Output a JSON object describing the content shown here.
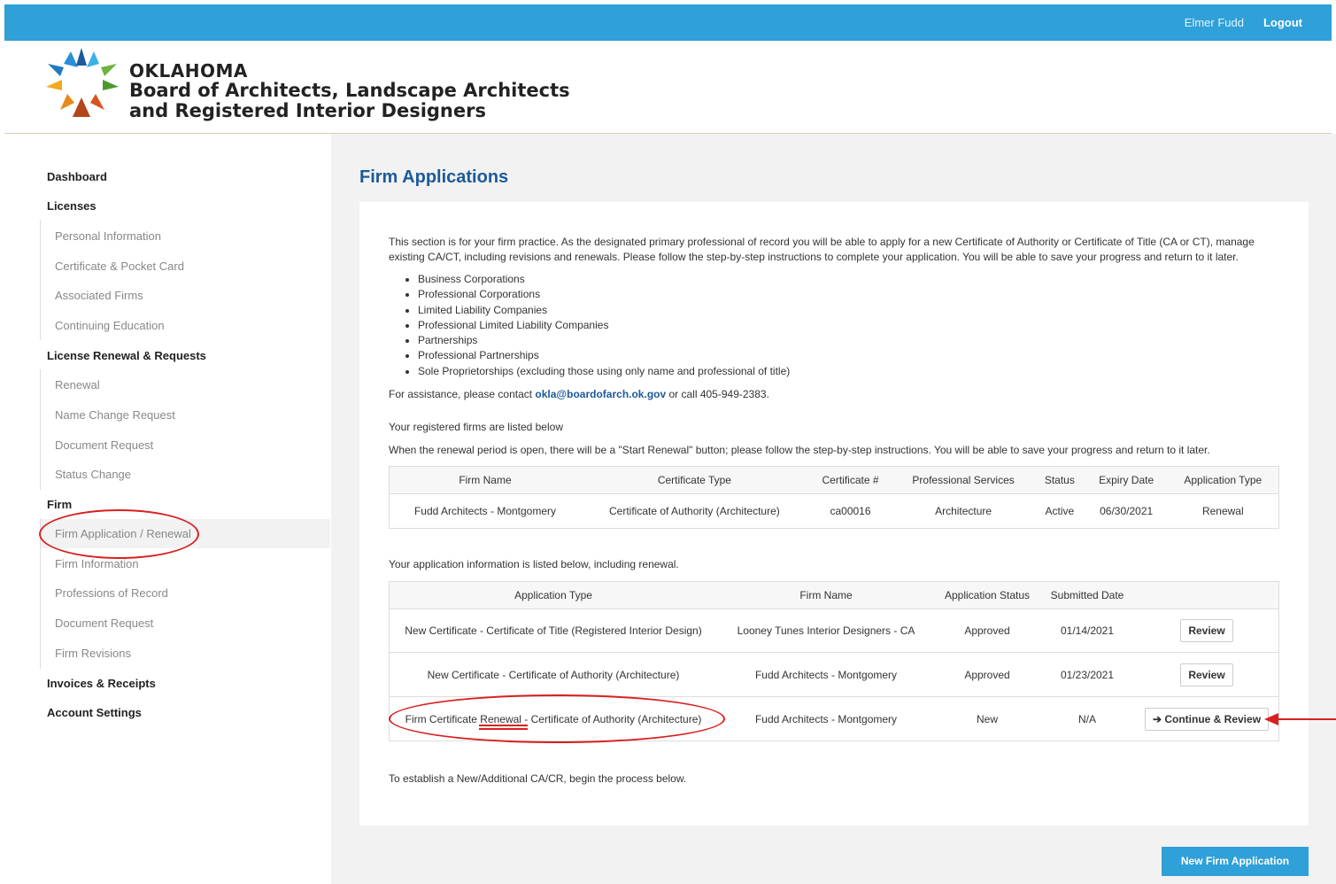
{
  "topbar": {
    "user_name": "Elmer Fudd",
    "logout_label": "Logout"
  },
  "brand": {
    "line1": "OKLAHOMA",
    "line2": "Board of Architects, Landscape Architects",
    "line3": "and Registered Interior Designers"
  },
  "sidebar": {
    "dashboard": "Dashboard",
    "licenses": "Licenses",
    "licenses_items": [
      "Personal Information",
      "Certificate & Pocket Card",
      "Associated Firms",
      "Continuing Education"
    ],
    "renewal_section": "License Renewal & Requests",
    "renewal_items": [
      "Renewal",
      "Name Change Request",
      "Document Request",
      "Status Change"
    ],
    "firm_section": "Firm",
    "firm_items": [
      "Firm Application / Renewal",
      "Firm Information",
      "Professions of Record",
      "Document Request",
      "Firm Revisions"
    ],
    "invoices": "Invoices & Receipts",
    "account": "Account Settings"
  },
  "main": {
    "title": "Firm Applications",
    "intro": "This section is for your firm practice. As the designated primary professional of record you will be able to apply for a new Certificate of Authority or Certificate of Title (CA or CT), manage existing CA/CT, including revisions and renewals. Please follow the step-by-step instructions to complete your application. You will be able to save your progress and return to it later.",
    "entity_types": [
      "Business Corporations",
      "Professional Corporations",
      "Limited Liability Companies",
      "Professional Limited Liability Companies",
      "Partnerships",
      "Professional Partnerships",
      "Sole Proprietorships (excluding those using only name and professional of title)"
    ],
    "assist_prefix": "For assistance, please contact ",
    "assist_email": "okla@boardofarch.ok.gov",
    "assist_suffix": " or call 405-949-2383.",
    "registered_heading": "Your registered firms are listed below",
    "renewal_note": "When the renewal period is open, there will be a \"Start Renewal\" button; please follow the step-by-step instructions. You will be able to save your progress and return to it later.",
    "firms_table": {
      "headers": [
        "Firm Name",
        "Certificate Type",
        "Certificate #",
        "Professional Services",
        "Status",
        "Expiry Date",
        "Application Type"
      ],
      "rows": [
        [
          "Fudd Architects - Montgomery",
          "Certificate of Authority (Architecture)",
          "ca00016",
          "Architecture",
          "Active",
          "06/30/2021",
          "Renewal"
        ]
      ]
    },
    "applications_heading": "Your application information is listed below, including renewal.",
    "apps_table": {
      "headers": [
        "Application Type",
        "Firm Name",
        "Application Status",
        "Submitted Date",
        ""
      ],
      "rows": [
        [
          "New Certificate - Certificate of Title (Registered Interior Design)",
          "Looney Tunes Interior Designers - CA",
          "Approved",
          "01/14/2021",
          "Review"
        ],
        [
          "New Certificate - Certificate of Authority (Architecture)",
          "Fudd Architects - Montgomery",
          "Approved",
          "01/23/2021",
          "Review"
        ],
        [
          "Firm Certificate Renewal - Certificate of Authority (Architecture)",
          "Fudd Architects - Montgomery",
          "New",
          "N/A",
          "Continue & Review"
        ]
      ]
    },
    "establish_note": "To establish a New/Additional CA/CR, begin the process below.",
    "new_firm_button": "New Firm Application"
  },
  "colors": {
    "topbar": "#2fa0d8",
    "title": "#1c5a99",
    "annotation": "#d82020"
  }
}
